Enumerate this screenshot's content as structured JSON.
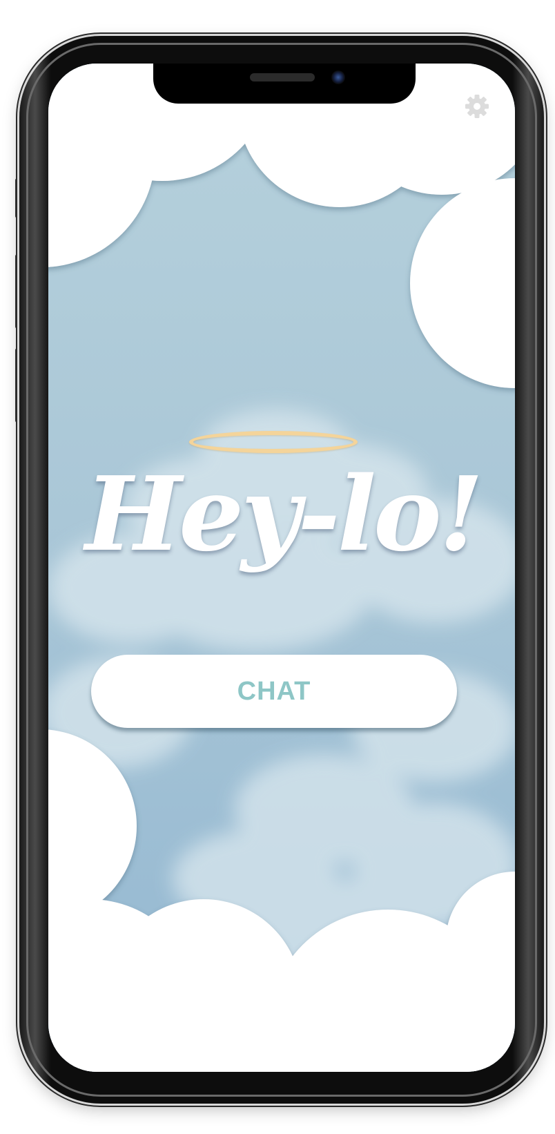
{
  "app": {
    "title": "Hey-lo!",
    "chat_button_label": "CHAT"
  },
  "icons": {
    "settings": "gear-icon",
    "halo": "halo-icon"
  },
  "colors": {
    "sky": "#a9c6d8",
    "cloud": "#ffffff",
    "halo": "#f4d49a",
    "chat_label": "#8ec6c6",
    "gear": "#dcdcdc"
  }
}
